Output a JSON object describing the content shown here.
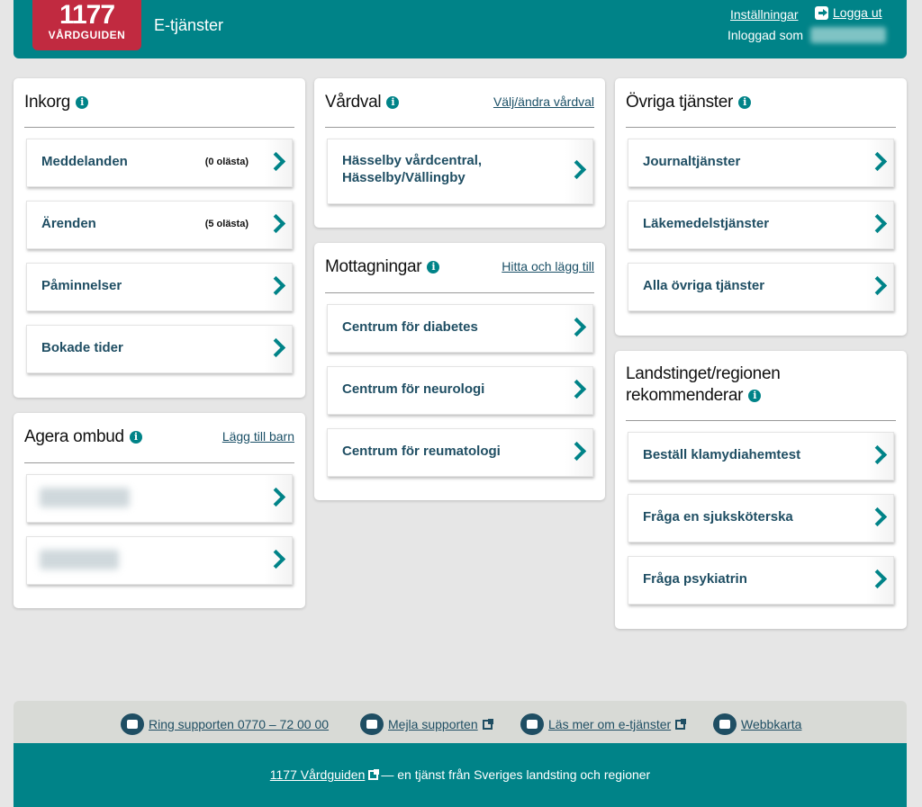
{
  "header": {
    "logo_number": "1177",
    "logo_text": "VÅRDGUIDEN",
    "app_title": "E-tjänster",
    "settings_label": "Inställningar",
    "logout_label": "Logga ut",
    "logged_in_label": "Inloggad som"
  },
  "inbox": {
    "title": "Inkorg",
    "items": [
      {
        "label": "Meddelanden",
        "count": "(0 olästa)"
      },
      {
        "label": "Ärenden",
        "count": "(5 olästa)"
      },
      {
        "label": "Påminnelser",
        "count": ""
      },
      {
        "label": "Bokade tider",
        "count": ""
      }
    ]
  },
  "proxy": {
    "title": "Agera ombud",
    "link": "Lägg till barn"
  },
  "care_choice": {
    "title": "Vårdval",
    "link": "Välj/ändra vårdval",
    "item_line1": "Hässelby vårdcentral,",
    "item_line2": "Hässelby/Vällingby"
  },
  "clinics": {
    "title": "Mottagningar",
    "link": "Hitta och lägg till",
    "items": [
      {
        "label": "Centrum för diabetes"
      },
      {
        "label": "Centrum för neurologi"
      },
      {
        "label": "Centrum för reumatologi"
      }
    ]
  },
  "other_services": {
    "title": "Övriga tjänster",
    "items": [
      {
        "label": "Journaltjänster"
      },
      {
        "label": "Läkemedelstjänster"
      },
      {
        "label": "Alla övriga tjänster"
      }
    ]
  },
  "recommended": {
    "title_line1": "Landstinget/regionen",
    "title_line2": "rekommenderar",
    "items": [
      {
        "label": "Beställ klamydiahemtest"
      },
      {
        "label": "Fråga en sjuksköterska"
      },
      {
        "label": "Fråga psykiatrin"
      }
    ]
  },
  "support": {
    "phone": "Ring supporten 0770 – 72 00 00",
    "email": "Mejla supporten",
    "read_more": "Läs mer om e-tjänster",
    "sitemap": "Webbkarta"
  },
  "footer": {
    "link": "1177 Vårdguiden",
    "text": "— en tjänst från Sveriges landsting och regioner"
  },
  "colors": {
    "brand": "#008388",
    "logo": "#c12a40",
    "link": "#1f4e63"
  }
}
